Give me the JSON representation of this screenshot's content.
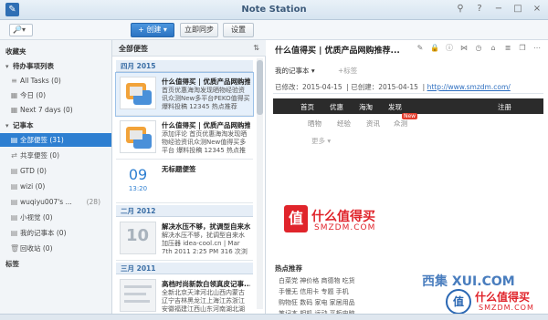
{
  "window": {
    "title": "Note Station"
  },
  "toolbar": {
    "search_placeholder": "",
    "search_glyph": "🔎▾",
    "create_label": "+ 创建",
    "create_arrow": "▾",
    "sync_label": "立即同步",
    "settings_label": "设置"
  },
  "sidebar": {
    "favorites": "收藏夹",
    "todo_head": "待办事项列表",
    "todo_items": [
      "All Tasks (0)",
      "今日 (0)",
      "Next 7 days (0)"
    ],
    "notebooks_head": "记事本",
    "notebooks": [
      {
        "label": "全部便签 (31)",
        "count": ""
      },
      {
        "label": "共享便签 (0)",
        "count": ""
      },
      {
        "label": "GTD (0)",
        "count": ""
      },
      {
        "label": "wizi (0)",
        "count": ""
      },
      {
        "label": "wuqiyu007's ...",
        "count": "(28)"
      },
      {
        "label": "小视觉 (0)",
        "count": ""
      },
      {
        "label": "我的记事本 (0)",
        "count": ""
      },
      {
        "label": "回收站 (0)",
        "count": ""
      }
    ],
    "tags_head": "标签"
  },
  "notelist": {
    "title": "全部便签",
    "sort": "⇅",
    "months": [
      "四月 2015",
      "二月 2012",
      "三月 2011"
    ],
    "notes": [
      {
        "title": "什么值得买 | 优质产品网购推荐...",
        "body": "首页优惠海淘发现晒物经验资讯众测New多平台PEKO值得买 爆料投稿 12345 热点推荐"
      },
      {
        "title": "什么值得买 | 优质产品网购推荐...",
        "body": "添加评论 首页优惠海淘发现晒物经验资讯众测New值得买多平台 爆料投稿 12345 热点推荐"
      },
      {
        "title": "无标题便签",
        "body": ""
      },
      {
        "title": "解决水压不够，扰调型自来水...",
        "body": "解决水压不够，扰调型自来水加压器 idea-cool.cn | Mar 7th 2011 2:25 PM 316 次浏览"
      },
      {
        "title": "高档时尚新款白领真皮记事...",
        "body": "全新北京天津河北山西内蒙古辽宁吉林黑龙江上海江苏浙江安徽福建江西山东河南湖北湖南"
      }
    ],
    "date_thumb": {
      "day": "09",
      "time": "13:20"
    },
    "big_thumb": "10"
  },
  "view": {
    "title": "什么值得买 | 优质产品网购推荐...",
    "notebook": "我的记事本 ▾",
    "tag_placeholder": "+标签",
    "modified_label": "已修改：",
    "modified": "2015-04-15",
    "created_label": "已创建：",
    "created": "2015-04-15",
    "url": "http://www.smzdm.com/",
    "clip_nav": [
      "首页",
      "优惠",
      "海淘",
      "发现",
      "注册"
    ],
    "clip_sub": [
      "晒物",
      "经验",
      "资讯",
      "众测"
    ],
    "new_badge": "New",
    "clip_more": "更多 ▾",
    "logo_char": "值",
    "logo_text": "什么值得买",
    "logo_sub": "SMZDM.COM",
    "hot_title": "热点推荐",
    "hot_rows": [
      "白菜党    神价格    商德物    吃货",
      "手慢无    信用卡    专题    手机",
      "购物狂    数码    家电    家居用品",
      "笔记本    相机    运动    平板电脑"
    ]
  },
  "watermark": {
    "site": "西集 XUI.COM",
    "seal": "值",
    "brand": "什么值得买",
    "domain": "SMZDM.COM"
  }
}
